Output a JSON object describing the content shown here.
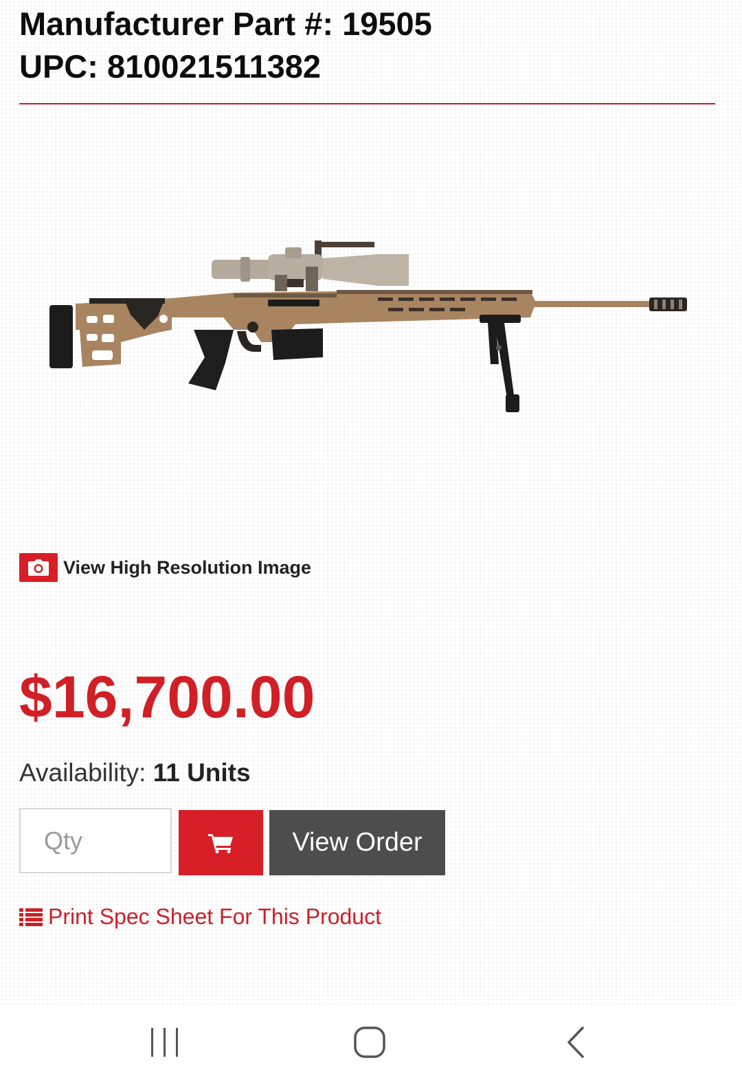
{
  "product": {
    "part_number_line": "Manufacturer Part #: 19505",
    "upc_line": "UPC: 810021511382"
  },
  "image": {
    "icon": "rifle-product-image",
    "colors": {
      "body": "#a98461",
      "scope": "#b7aea0",
      "black": "#1c1c1c"
    }
  },
  "hires": {
    "icon": "camera-icon",
    "label": "View High Resolution Image"
  },
  "pricing": {
    "price": "$16,700.00"
  },
  "availability": {
    "label": "Availability:",
    "units": "11 Units"
  },
  "order": {
    "qty_placeholder": "Qty",
    "cart_icon": "cart-icon",
    "view_order_label": "View Order"
  },
  "spec_sheet": {
    "icon": "list-icon",
    "label": "Print Spec Sheet For This Product"
  },
  "nav": {
    "icons": [
      "recent-apps-icon",
      "home-icon",
      "back-icon"
    ]
  },
  "colors": {
    "accent_red": "#d71f27",
    "dark_button": "#4d4d4d"
  }
}
